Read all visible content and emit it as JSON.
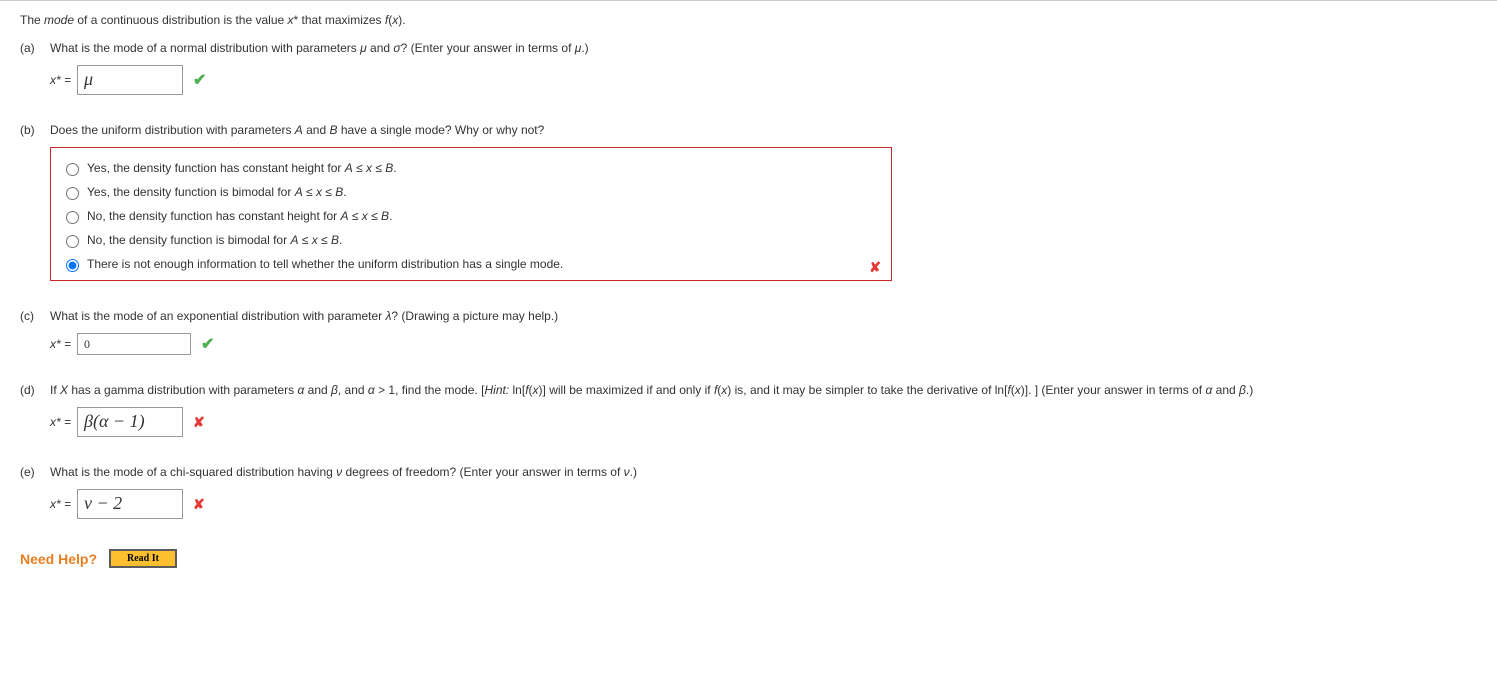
{
  "intro_html": "The <em>mode</em> of a continuous distribution is the value <em>x</em>* that maximizes <em>f</em>(<em>x</em>).",
  "parts": {
    "a": {
      "label": "(a)",
      "question_html": "What is the mode of a normal distribution with parameters <em>μ</em> and <em>σ</em>? (Enter your answer in terms of <em>μ</em>.)",
      "xstar": "x* =",
      "answer": "μ",
      "status": "correct"
    },
    "b": {
      "label": "(b)",
      "question_html": "Does the uniform distribution with parameters <em>A</em> and <em>B</em> have a single mode? Why or why not?",
      "options": [
        "Yes, the density function has constant height for A ≤ x ≤ B.",
        "Yes, the density function is bimodal for A ≤ x ≤ B.",
        "No, the density function has constant height for A ≤ x ≤ B.",
        "No, the density function is bimodal for A ≤ x ≤ B.",
        "There is not enough information to tell whether the uniform distribution has a single mode."
      ],
      "selected_index": 4,
      "status": "wrong"
    },
    "c": {
      "label": "(c)",
      "question_html": "What is the mode of an exponential distribution with parameter <em>λ</em>? (Drawing a picture may help.)",
      "xstar": "x* =",
      "answer": "0",
      "status": "correct"
    },
    "d": {
      "label": "(d)",
      "question_html": "If <em>X</em> has a gamma distribution with parameters <em>α</em> and <em>β</em>, and <em>α</em> &gt; 1, find the mode. [<em>Hint:</em> ln[<em>f</em>(<em>x</em>)] will be maximized if and only if <em>f</em>(<em>x</em>) is, and it may be simpler to take the derivative of ln[<em>f</em>(<em>x</em>)]. ] (Enter your answer in terms of <em>α</em> and <em>β</em>.)",
      "xstar": "x* =",
      "answer": "β(α − 1)",
      "status": "wrong"
    },
    "e": {
      "label": "(e)",
      "question_html": "What is the mode of a chi-squared distribution having <em>ν</em> degrees of freedom? (Enter your answer in terms of <em>ν</em>.)",
      "xstar": "x* =",
      "answer": "ν − 2",
      "status": "wrong"
    }
  },
  "need_help": {
    "label": "Need Help?",
    "read_it": "Read It"
  },
  "opt_html": [
    "Yes, the density function has constant height for <em>A</em> ≤ <em>x</em> ≤ <em>B</em>.",
    "Yes, the density function is bimodal for <em>A</em> ≤ <em>x</em> ≤ <em>B</em>.",
    "No, the density function has constant height for <em>A</em> ≤ <em>x</em> ≤ <em>B</em>.",
    "No, the density function is bimodal for <em>A</em> ≤ <em>x</em> ≤ <em>B</em>.",
    "There is not enough information to tell whether the uniform distribution has a single mode."
  ]
}
